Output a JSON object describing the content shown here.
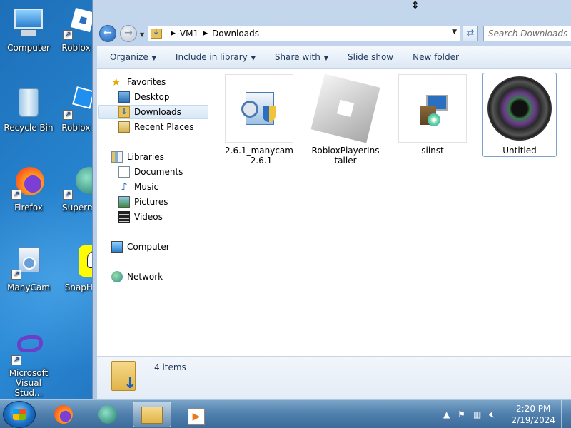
{
  "desktop": {
    "icons": [
      {
        "label": "Computer",
        "icon": "computer-icon"
      },
      {
        "label": "Roblox P",
        "icon": "roblox-icon"
      },
      {
        "label": "Recycle Bin",
        "icon": "recycle-bin-icon"
      },
      {
        "label": "Roblox S",
        "icon": "roblox-studio-icon"
      },
      {
        "label": "Firefox",
        "icon": "firefox-icon"
      },
      {
        "label": "Supermi",
        "icon": "supermium-icon"
      },
      {
        "label": "ManyCam",
        "icon": "manycam-icon"
      },
      {
        "label": "SnapHi",
        "icon": "snapchat-icon"
      },
      {
        "label": "Microsoft Visual Stud...",
        "icon": "visual-studio-icon"
      }
    ]
  },
  "explorer": {
    "breadcrumb": [
      "VM1",
      "Downloads"
    ],
    "search_placeholder": "Search Downloads",
    "toolbar": {
      "organize": "Organize",
      "include_in_library": "Include in library",
      "share_with": "Share with",
      "slide_show": "Slide show",
      "new_folder": "New folder"
    },
    "nav": {
      "favorites": "Favorites",
      "desktop": "Desktop",
      "downloads": "Downloads",
      "recent_places": "Recent Places",
      "libraries": "Libraries",
      "documents": "Documents",
      "music": "Music",
      "pictures": "Pictures",
      "videos": "Videos",
      "computer": "Computer",
      "network": "Network"
    },
    "files": [
      {
        "name": "2.6.1_manycam_2.6.1",
        "icon": "manycam-installer-icon"
      },
      {
        "name": "RobloxPlayerInstaller",
        "icon": "roblox-installer-icon"
      },
      {
        "name": "siinst",
        "icon": "setup-installer-icon"
      },
      {
        "name": "Untitled",
        "icon": "camera-lens-icon"
      }
    ],
    "status": {
      "count": "4 items"
    }
  },
  "taskbar": {
    "clock_time": "2:20 PM",
    "clock_date": "2/19/2024"
  }
}
